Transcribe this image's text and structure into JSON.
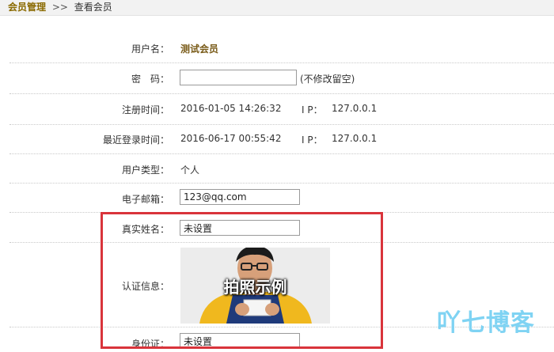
{
  "breadcrumb": {
    "root": "会员管理",
    "separator": ">>",
    "current": "查看会员"
  },
  "fields": {
    "username": {
      "label": "用户名：",
      "value": "测试会员"
    },
    "password": {
      "label": "密　码：",
      "value": "",
      "hint": "(不修改留空)"
    },
    "register_time": {
      "label": "注册时间：",
      "value": "2016-01-05 14:26:32",
      "ip_label": "I P：",
      "ip": "127.0.0.1"
    },
    "last_login": {
      "label": "最近登录时间：",
      "value": "2016-06-17 00:55:42",
      "ip_label": "I P：",
      "ip": "127.0.0.1"
    },
    "user_type": {
      "label": "用户类型：",
      "value": "个人"
    },
    "email": {
      "label": "电子邮箱：",
      "value": "123@qq.com"
    },
    "real_name": {
      "label": "真实姓名：",
      "value": "未设置"
    },
    "cert_info": {
      "label": "认证信息：",
      "photo_caption": "拍照示例"
    },
    "id_card": {
      "label": "身份证：",
      "value": "未设置"
    }
  },
  "watermark": "吖七博客",
  "colors": {
    "highlight_box": "#d9343b",
    "watermark": "#7fd3f3",
    "topbar": "#f2f2f2"
  }
}
